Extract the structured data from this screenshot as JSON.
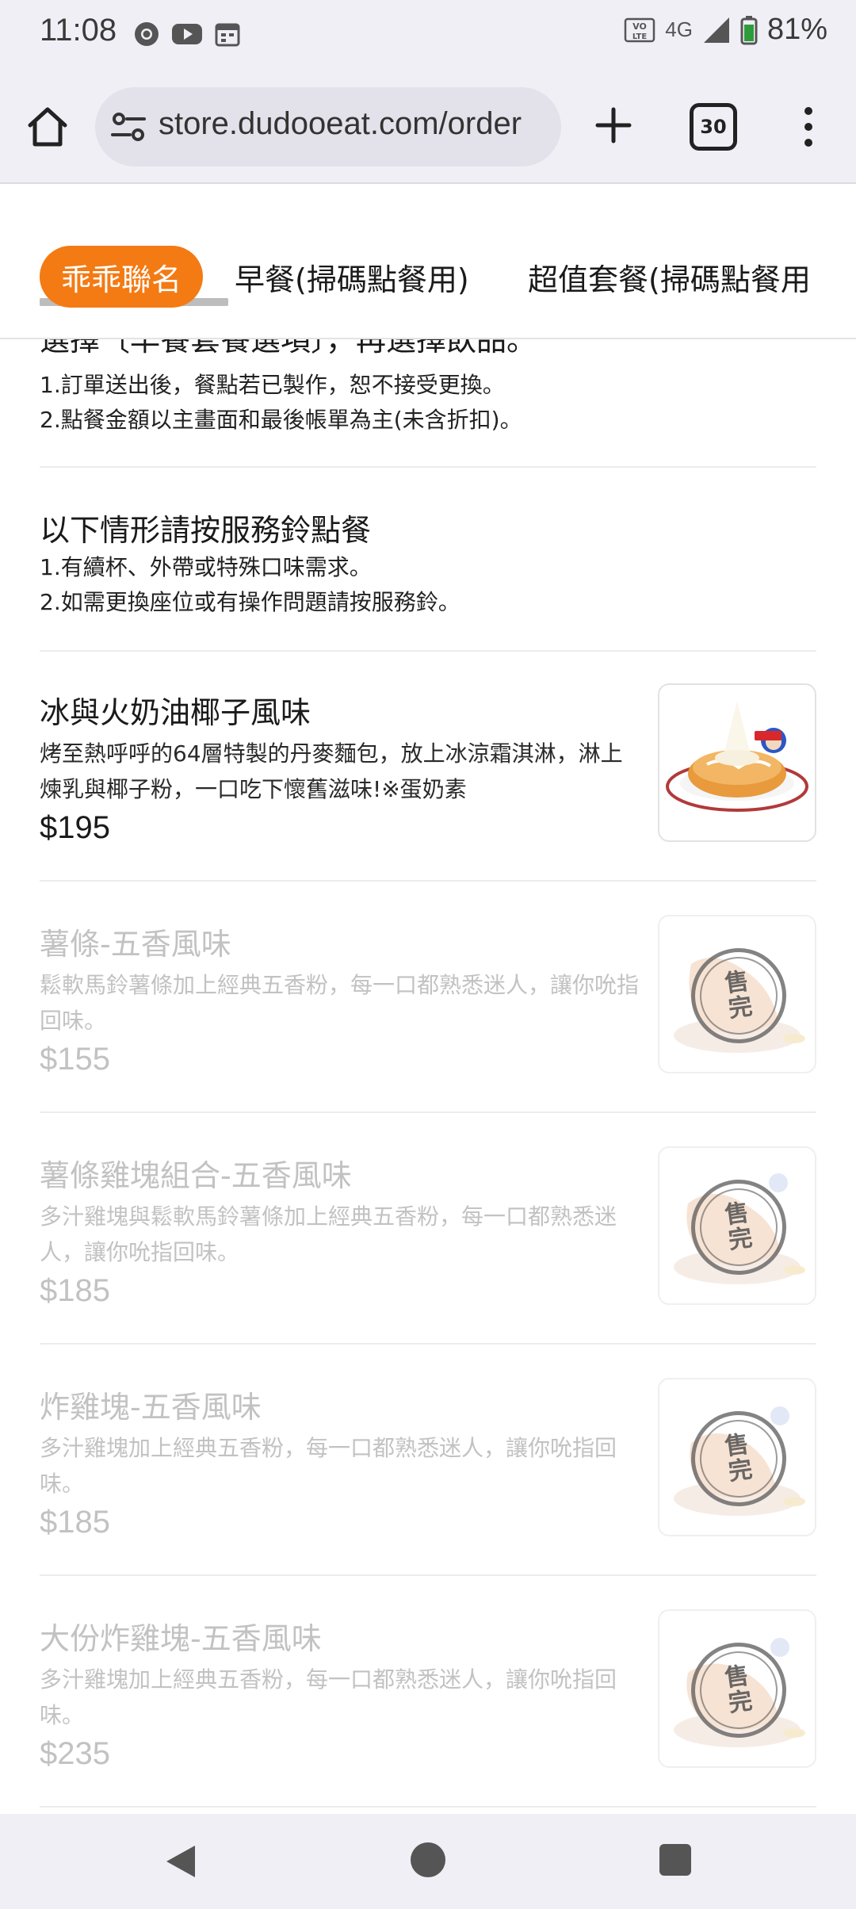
{
  "status_bar": {
    "time": "11:08",
    "battery": "81%",
    "network": "4G",
    "volte": "VO LTE",
    "icons_left": [
      "chrome-icon",
      "youtube-icon",
      "calendar-icon"
    ],
    "icons_right": [
      "volte-icon",
      "signal-icon",
      "battery-icon"
    ]
  },
  "browser": {
    "url": "store.dudooeat.com/order",
    "tab_count": "30"
  },
  "categories": {
    "tabs": [
      "乖乖聯名",
      "早餐(掃碼點餐用)",
      "超值套餐(掃碼點餐用"
    ],
    "active_index": 0,
    "accent": "#f47a13"
  },
  "notices": {
    "partial_heading": "選擇〔早餐套餐選項〕，再選擇飲品。",
    "lines_1": [
      "1.訂單送出後，餐點若已製作，恕不接受更換。",
      "2.點餐金額以主畫面和最後帳單為主(未含折扣)。"
    ],
    "section2_title": "以下情形請按服務鈴點餐",
    "lines_2": [
      "1.有續杯、外帶或特殊口味需求。",
      "2.如需更換座位或有操作問題請按服務鈴。"
    ]
  },
  "items": [
    {
      "name": "冰與火奶油椰子風味",
      "desc": "烤至熱呼呼的64層特製的丹麥麵包，放上冰涼霜淇淋，淋上煉乳與椰子粉，一口吃下懷舊滋味!※蛋奶素",
      "price": "$195",
      "sold_out": false
    },
    {
      "name": "薯條-五香風味",
      "desc": "鬆軟馬鈴薯條加上經典五香粉，每一口都熟悉迷人，讓你吮指回味。",
      "price": "$155",
      "sold_out": true
    },
    {
      "name": "薯條雞塊組合-五香風味",
      "desc": "多汁雞塊與鬆軟馬鈴薯條加上經典五香粉，每一口都熟悉迷人，讓你吮指回味。",
      "price": "$185",
      "sold_out": true
    },
    {
      "name": "炸雞塊-五香風味",
      "desc": "多汁雞塊加上經典五香粉，每一口都熟悉迷人，讓你吮指回味。",
      "price": "$185",
      "sold_out": true
    },
    {
      "name": "大份炸雞塊-五香風味",
      "desc": "多汁雞塊加上經典五香粉，每一口都熟悉迷人，讓你吮指回味。",
      "price": "$235",
      "sold_out": true
    }
  ],
  "sold_out_stamp": [
    "售",
    "完"
  ],
  "nav": {
    "icons": [
      "back-icon",
      "home-circle-icon",
      "recents-icon"
    ]
  }
}
